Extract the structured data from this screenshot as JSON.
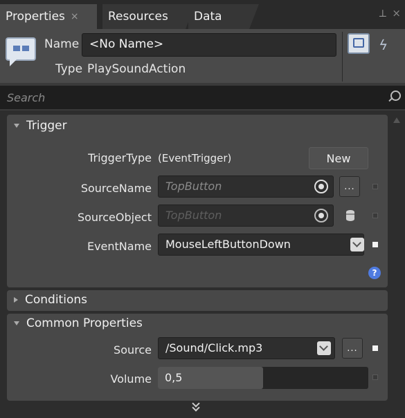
{
  "tabs": [
    {
      "label": "Properties",
      "close": "×"
    },
    {
      "label": "Resources"
    },
    {
      "label": "Data"
    }
  ],
  "window_controls": {
    "pin": "⯈",
    "close": "×"
  },
  "header": {
    "name_label": "Name",
    "name_value": "<No Name>",
    "type_label": "Type",
    "type_value": "PlaySoundAction"
  },
  "search": {
    "placeholder": "Search"
  },
  "trigger": {
    "title": "Trigger",
    "trigger_type_label": "TriggerType",
    "trigger_type_value": "(EventTrigger)",
    "new_button": "New",
    "source_name_label": "SourceName",
    "source_name_value": "TopButton",
    "source_object_label": "SourceObject",
    "source_object_value": "TopButton",
    "event_name_label": "EventName",
    "event_name_value": "MouseLeftButtonDown",
    "ellipsis": "...",
    "help": "?"
  },
  "conditions": {
    "title": "Conditions"
  },
  "common": {
    "title": "Common Properties",
    "source_label": "Source",
    "source_value": "/Sound/Click.mp3",
    "volume_label": "Volume",
    "volume_value": "0,5",
    "volume_fraction": 0.5,
    "ellipsis": "..."
  }
}
